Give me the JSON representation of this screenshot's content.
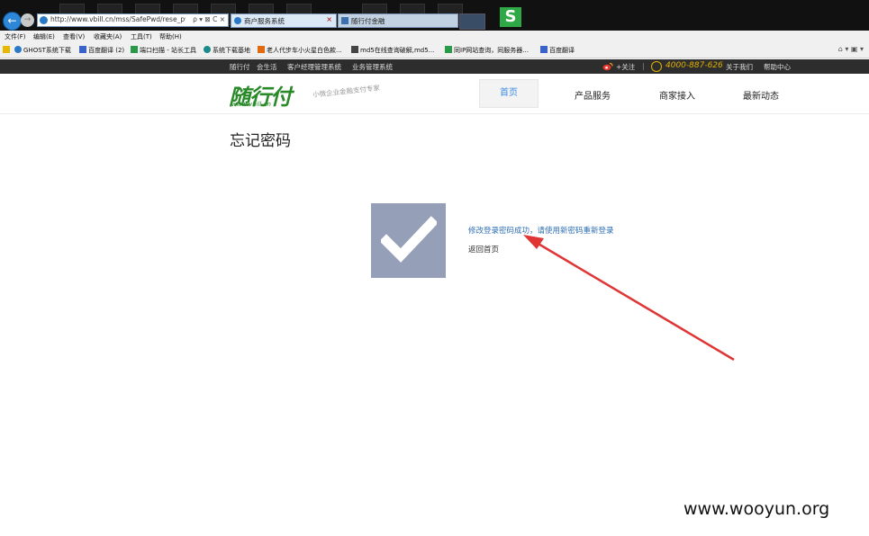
{
  "browser": {
    "address_url": "http://www.vbill.cn/mss/SafePwd/rese_pw",
    "address_icons": "ρ ▾ ⊠ C ×",
    "tabs": [
      {
        "label": "商户服务系统",
        "close": "×"
      },
      {
        "label": "随行付金融"
      }
    ],
    "menu": [
      "文件(F)",
      "编辑(E)",
      "查看(V)",
      "收藏夹(A)",
      "工具(T)",
      "帮助(H)"
    ],
    "favorites": [
      "GHOST系统下载",
      "百度翻译 (2)",
      "端口扫描 - 站长工具",
      "系统下载基地",
      "老人代步车小火星白色款...",
      "md5在线查询破解,md5...",
      "同IP网站查询，同服务器...",
      "百度翻译"
    ],
    "fav_tools": "⌂ ▾ ▣ ▾"
  },
  "site": {
    "topbar": {
      "left_links": [
        "随行付",
        "会生活",
        "客户经理管理系统",
        "业务管理系统"
      ],
      "follow": "+关注",
      "separator": "|",
      "hotline": "4000-887-626",
      "right_links": [
        "关于我们",
        "帮助中心"
      ]
    },
    "header": {
      "logo": "随行付",
      "logo_url": "www.vbill.cn",
      "slogan": "小微企业金融支付专家",
      "nav": [
        "首页",
        "产品服务",
        "商家接入",
        "最新动态"
      ]
    },
    "content": {
      "title": "忘记密码",
      "success_message": "修改登录密码成功，请使用新密码重新登录",
      "back_home": "返回首页"
    }
  },
  "colors": {
    "accent_blue": "#3a8be0",
    "logo_green": "#2a8a2a",
    "hotline_gold": "#e0b000",
    "success_box": "#959fb8",
    "annotation_arrow": "#e03535"
  },
  "watermark": "www.wooyun.org"
}
